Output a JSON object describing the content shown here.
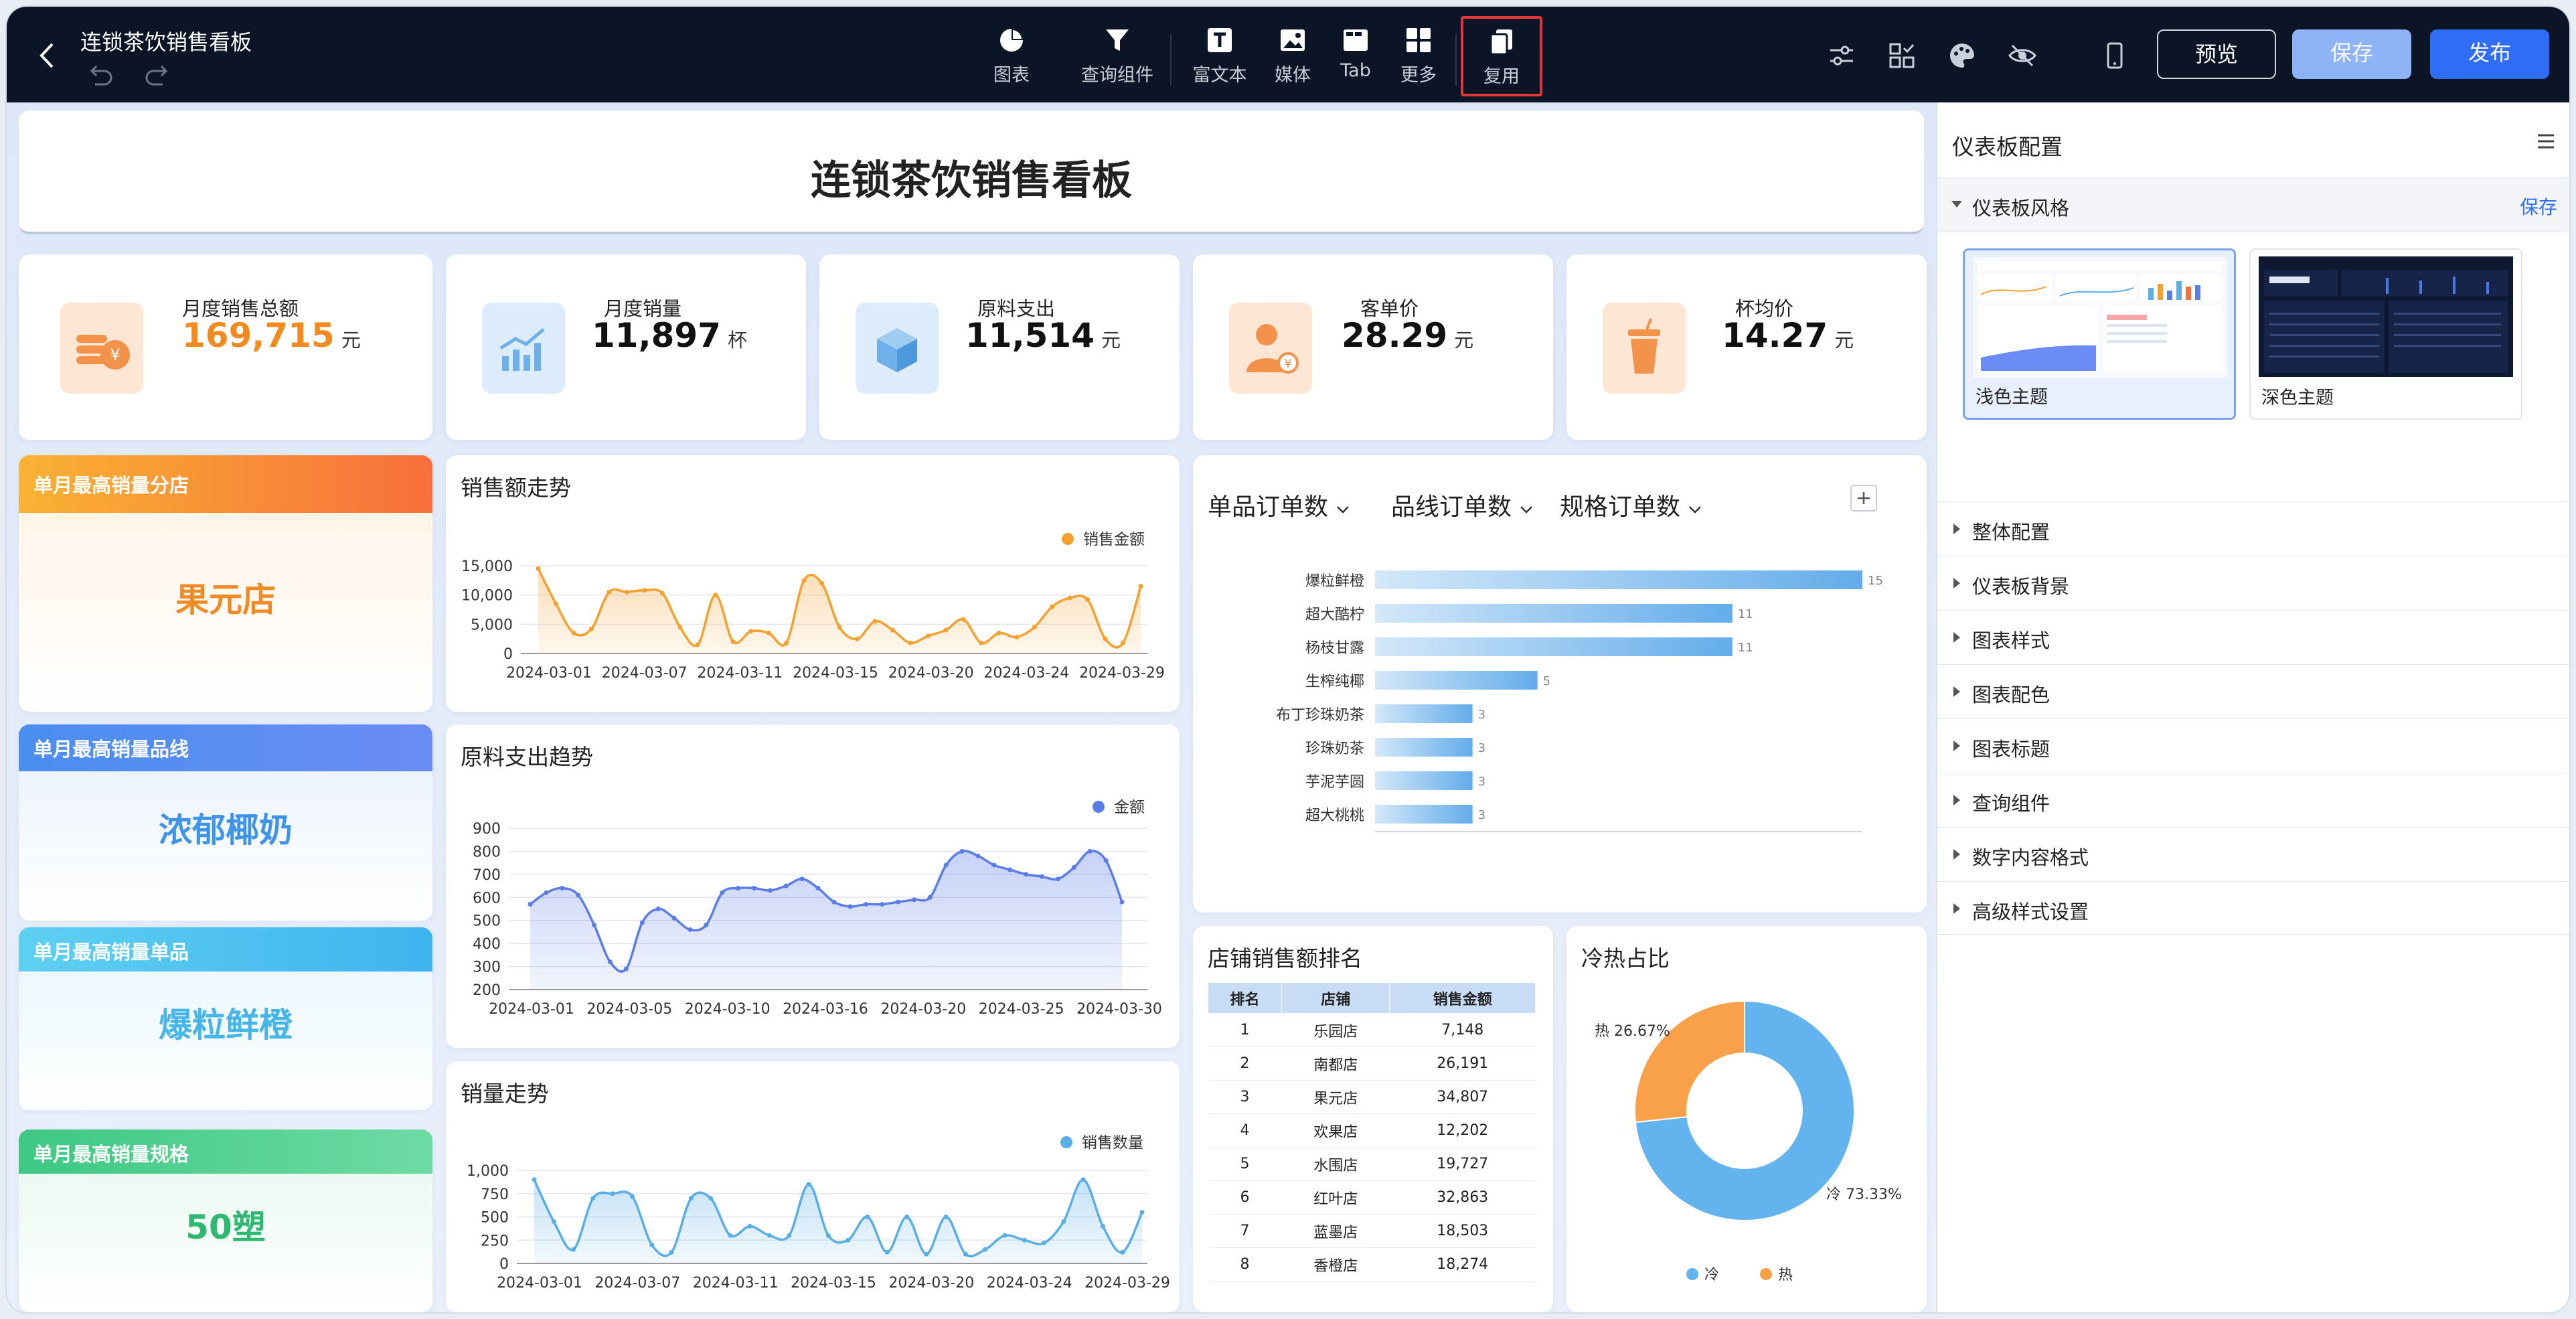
{
  "header": {
    "title": "连锁茶饮销售看板",
    "tools": [
      {
        "label": "图表",
        "icon": "pie-chart-icon"
      },
      {
        "label": "查询组件",
        "icon": "filter-icon"
      },
      {
        "label": "富文本",
        "icon": "text-icon"
      },
      {
        "label": "媒体",
        "icon": "image-icon"
      },
      {
        "label": "Tab",
        "icon": "tab-icon"
      },
      {
        "label": "更多",
        "icon": "grid-icon"
      },
      {
        "label": "复用",
        "icon": "copy-icon"
      }
    ],
    "buttons": {
      "preview": "预览",
      "save": "保存",
      "publish": "发布"
    }
  },
  "dashboard": {
    "title": "连锁茶饮销售看板",
    "kpis": [
      {
        "label": "月度销售总额",
        "value": "169,715",
        "unit": "元"
      },
      {
        "label": "月度销量",
        "value": "11,897",
        "unit": "杯"
      },
      {
        "label": "原料支出",
        "value": "11,514",
        "unit": "元"
      },
      {
        "label": "客单价",
        "value": "28.29",
        "unit": "元"
      },
      {
        "label": "杯均价",
        "value": "14.27",
        "unit": "元"
      }
    ],
    "tags": [
      {
        "label": "单月最高销量分店",
        "value": "果元店"
      },
      {
        "label": "单月最高销量品线",
        "value": "浓郁椰奶"
      },
      {
        "label": "单月最高销量单品",
        "value": "爆粒鲜橙"
      },
      {
        "label": "单月最高销量规格",
        "value": "50塑"
      }
    ],
    "bar_tabs": [
      "单品订单数",
      "品线订单数",
      "规格订单数"
    ],
    "ranking_title": "店铺销售额排名",
    "ranking_headers": [
      "排名",
      "店铺",
      "销售金额"
    ],
    "ranking_rows": [
      [
        "1",
        "乐园店",
        "7,148"
      ],
      [
        "2",
        "南都店",
        "26,191"
      ],
      [
        "3",
        "果元店",
        "34,807"
      ],
      [
        "4",
        "欢果店",
        "12,202"
      ],
      [
        "5",
        "水围店",
        "19,727"
      ],
      [
        "6",
        "红叶店",
        "32,863"
      ],
      [
        "7",
        "蓝墨店",
        "18,503"
      ],
      [
        "8",
        "香橙店",
        "18,274"
      ]
    ]
  },
  "chart_data": [
    {
      "type": "area",
      "title": "销售额走势",
      "series": [
        {
          "name": "销售金额",
          "values": [
            14500,
            8500,
            3500,
            4200,
            10500,
            10500,
            10800,
            10300,
            4500,
            1500,
            10000,
            2000,
            3800,
            3500,
            1800,
            12500,
            12000,
            4500,
            2500,
            5500,
            4000,
            1800,
            3000,
            4000,
            5800,
            1800,
            3500,
            2800,
            4500,
            8000,
            9500,
            9200,
            2500,
            1800,
            11500
          ]
        }
      ],
      "xticks": [
        "2024-03-01",
        "2024-03-07",
        "2024-03-11",
        "2024-03-15",
        "2024-03-20",
        "2024-03-24",
        "2024-03-29"
      ],
      "yticks": [
        "0",
        "5,000",
        "10,000",
        "15,000"
      ],
      "ylim": [
        0,
        15000
      ],
      "color": "#f6a02d"
    },
    {
      "type": "area",
      "title": "原料支出趋势",
      "series": [
        {
          "name": "金额",
          "values": [
            570,
            620,
            640,
            610,
            480,
            320,
            290,
            490,
            550,
            510,
            460,
            480,
            620,
            640,
            640,
            630,
            650,
            680,
            640,
            580,
            560,
            570,
            570,
            580,
            590,
            600,
            740,
            800,
            780,
            740,
            720,
            700,
            690,
            680,
            730,
            800,
            760,
            580
          ]
        }
      ],
      "xticks": [
        "2024-03-01",
        "2024-03-05",
        "2024-03-10",
        "2024-03-16",
        "2024-03-20",
        "2024-03-25",
        "2024-03-30"
      ],
      "yticks": [
        "200",
        "300",
        "400",
        "500",
        "600",
        "700",
        "800",
        "900"
      ],
      "ylim": [
        200,
        900
      ],
      "color": "#5b7de8"
    },
    {
      "type": "area",
      "title": "销量走势",
      "series": [
        {
          "name": "销售数量",
          "values": [
            900,
            450,
            150,
            700,
            750,
            720,
            200,
            120,
            700,
            700,
            300,
            400,
            300,
            300,
            850,
            300,
            250,
            500,
            120,
            500,
            100,
            500,
            100,
            150,
            300,
            250,
            220,
            450,
            900,
            400,
            120,
            550
          ]
        }
      ],
      "xticks": [
        "2024-03-01",
        "2024-03-07",
        "2024-03-11",
        "2024-03-15",
        "2024-03-20",
        "2024-03-24",
        "2024-03-29"
      ],
      "yticks": [
        "0",
        "250",
        "500",
        "750",
        "1,000"
      ],
      "ylim": [
        0,
        1000
      ],
      "color": "#5aaee6"
    },
    {
      "type": "bar",
      "orientation": "horizontal",
      "categories": [
        "爆粒鲜橙",
        "超大酷柠",
        "杨枝甘露",
        "生榨纯椰",
        "布丁珍珠奶茶",
        "珍珠奶茶",
        "芋泥芋圆",
        "超大桃桃"
      ],
      "values": [
        15,
        11,
        11,
        5,
        3,
        3,
        3,
        3
      ],
      "xlim": [
        0,
        15
      ]
    },
    {
      "type": "pie",
      "title": "冷热占比",
      "categories": [
        "冷",
        "热"
      ],
      "values": [
        73.33,
        26.67
      ],
      "labels": [
        "冷 73.33%",
        "热 26.67%"
      ],
      "colors": [
        "#62b3ee",
        "#f8a14a"
      ]
    }
  ],
  "panel": {
    "title": "仪表板配置",
    "style_section": "仪表板风格",
    "style_save": "保存",
    "themes": [
      {
        "label": "浅色主题"
      },
      {
        "label": "深色主题"
      }
    ],
    "accordions": [
      "整体配置",
      "仪表板背景",
      "图表样式",
      "图表配色",
      "图表标题",
      "查询组件",
      "数字内容格式",
      "高级样式设置"
    ]
  }
}
